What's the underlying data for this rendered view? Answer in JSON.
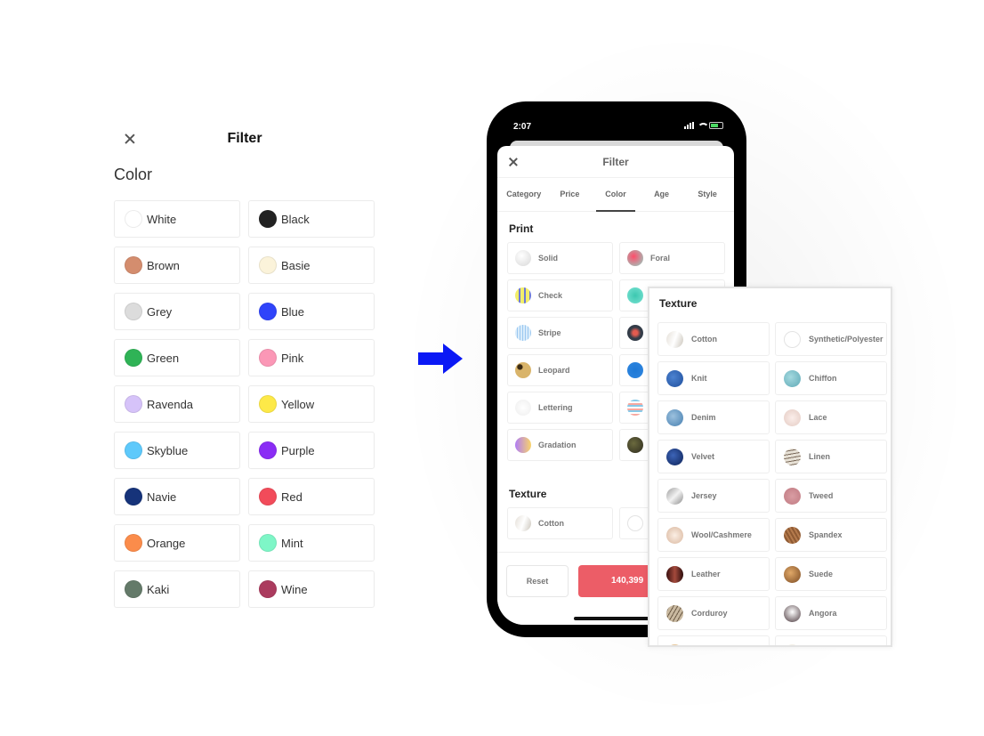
{
  "left": {
    "title": "Filter",
    "section": "Color",
    "colors": [
      {
        "label": "White",
        "hex": "#ffffff"
      },
      {
        "label": "Black",
        "hex": "#222222"
      },
      {
        "label": "Brown",
        "hex": "#d48d6e"
      },
      {
        "label": "Basie",
        "hex": "#fbf3da"
      },
      {
        "label": "Grey",
        "hex": "#dcdcdc"
      },
      {
        "label": "Blue",
        "hex": "#2f44fa"
      },
      {
        "label": "Green",
        "hex": "#2fb356"
      },
      {
        "label": "Pink",
        "hex": "#fb97b6"
      },
      {
        "label": "Ravenda",
        "hex": "#d6c3f9"
      },
      {
        "label": "Yellow",
        "hex": "#fde948"
      },
      {
        "label": "Skyblue",
        "hex": "#5ec9fb"
      },
      {
        "label": "Purple",
        "hex": "#8a2cf5"
      },
      {
        "label": "Navie",
        "hex": "#16337a"
      },
      {
        "label": "Red",
        "hex": "#f24b5a"
      },
      {
        "label": "Orange",
        "hex": "#fb8c4b"
      },
      {
        "label": "Mint",
        "hex": "#7ef6c7"
      },
      {
        "label": "Kaki",
        "hex": "#647a69"
      },
      {
        "label": "Wine",
        "hex": "#ab3b5e"
      }
    ]
  },
  "arrow_color": "#0a18f5",
  "phone": {
    "status_time": "2:07",
    "title": "Filter",
    "tabs": [
      {
        "label": "Category",
        "active": false
      },
      {
        "label": "Price",
        "active": false
      },
      {
        "label": "Color",
        "active": true
      },
      {
        "label": "Age",
        "active": false
      },
      {
        "label": "Style",
        "active": false
      }
    ],
    "print_section": "Print",
    "prints": [
      {
        "label": "Solid",
        "fill": "radial-gradient(circle at 40% 35%, #ffffff, #d8d8d8)"
      },
      {
        "label": "Foral",
        "fill": "radial-gradient(circle at 40% 40%, #ff4d6a, #8fd6c8)"
      },
      {
        "label": "Check",
        "fill": "repeating-linear-gradient(90deg, #f2ee6a 0 4px, #6c79d8 4px 6px)"
      },
      {
        "label": "",
        "fill": "radial-gradient(circle, #3cc7b0, #7be3d3)"
      },
      {
        "label": "Stripe",
        "fill": "repeating-linear-gradient(90deg, #d9ecfb 0 2px, #9cc8f0 2px 3px)"
      },
      {
        "label": "",
        "fill": "radial-gradient(circle, #e35b4f 20%, #333c48 50%)"
      },
      {
        "label": "Leopard",
        "fill": "radial-gradient(circle at 30% 30%, #3a2a14 15%, #d9b46a 20%)"
      },
      {
        "label": "",
        "fill": "radial-gradient(circle, #1f79d6, #2f86e0)"
      },
      {
        "label": "Lettering",
        "fill": "radial-gradient(circle, #ffffff, #eeeeee)"
      },
      {
        "label": "",
        "fill": "repeating-linear-gradient(0deg, #f7a8a0 0 2px, #ffffff 2px 4px, #88c9e8 4px 6px)"
      },
      {
        "label": "Gradation",
        "fill": "linear-gradient(90deg, #b07df5, #f9d46a)"
      },
      {
        "label": "",
        "fill": "radial-gradient(circle at 40% 40%, #6b6a3e, #2d2b1e)"
      }
    ],
    "texture_section": "Texture",
    "textures_visible": [
      {
        "label": "Cotton",
        "fill": "linear-gradient(110deg, #e5e0d8, #ffffff, #cbc5bb)"
      },
      {
        "label": "",
        "fill": "#ffffff"
      }
    ],
    "reset_label": "Reset",
    "apply_label": "140,399",
    "apply_color": "#ec5d67"
  },
  "texture_panel": {
    "title": "Texture",
    "items": [
      {
        "label": "Cotton",
        "fill": "linear-gradient(110deg, #e5e0d8, #ffffff, #cbc5bb)"
      },
      {
        "label": "Synthetic/Polyester",
        "fill": "#ffffff"
      },
      {
        "label": "Knit",
        "fill": "radial-gradient(circle at 40% 40%, #4c82d0, #1f4f9d)"
      },
      {
        "label": "Chiffon",
        "fill": "radial-gradient(circle at 40% 40%, #a4d9df, #5fa9b6)"
      },
      {
        "label": "Denim",
        "fill": "radial-gradient(circle at 40% 40%, #9cc1de, #467fb0)"
      },
      {
        "label": "Lace",
        "fill": "radial-gradient(circle, #fbeeea, #e4cbc3)"
      },
      {
        "label": "Velvet",
        "fill": "radial-gradient(circle at 40% 40%, #3c64b8, #0d2257)"
      },
      {
        "label": "Linen",
        "fill": "repeating-linear-gradient(170deg, #e7e1d6 0 3px, #7b6a5b 3px 4px)"
      },
      {
        "label": "Jersey",
        "fill": "linear-gradient(135deg, #9d9d9d, #f2f2f2, #8a8a8a)"
      },
      {
        "label": "Tweed",
        "fill": "radial-gradient(circle, #d99da3, #c07a82)"
      },
      {
        "label": "Wool/Cashmere",
        "fill": "radial-gradient(circle, #fbeee4, #d9b79e)"
      },
      {
        "label": "Spandex",
        "fill": "repeating-linear-gradient(60deg, #8e5a33 0 2px, #b47a4c 2px 4px)"
      },
      {
        "label": "Leather",
        "fill": "linear-gradient(90deg, #3a1010, #a44a3c, #2b0c0c)"
      },
      {
        "label": "Suede",
        "fill": "radial-gradient(circle at 40% 40%, #e0a868, #7b4a22)"
      },
      {
        "label": "Corduroy",
        "fill": "repeating-linear-gradient(120deg, #c9b9a0 0 3px, #6e5d48 3px 4px)"
      },
      {
        "label": "Angora",
        "fill": "radial-gradient(circle at 50% 40%, #ffffff, #4c3a3f)"
      },
      {
        "label": "",
        "fill": "#e7c79a"
      },
      {
        "label": "",
        "fill": "#f3efe6"
      }
    ]
  }
}
